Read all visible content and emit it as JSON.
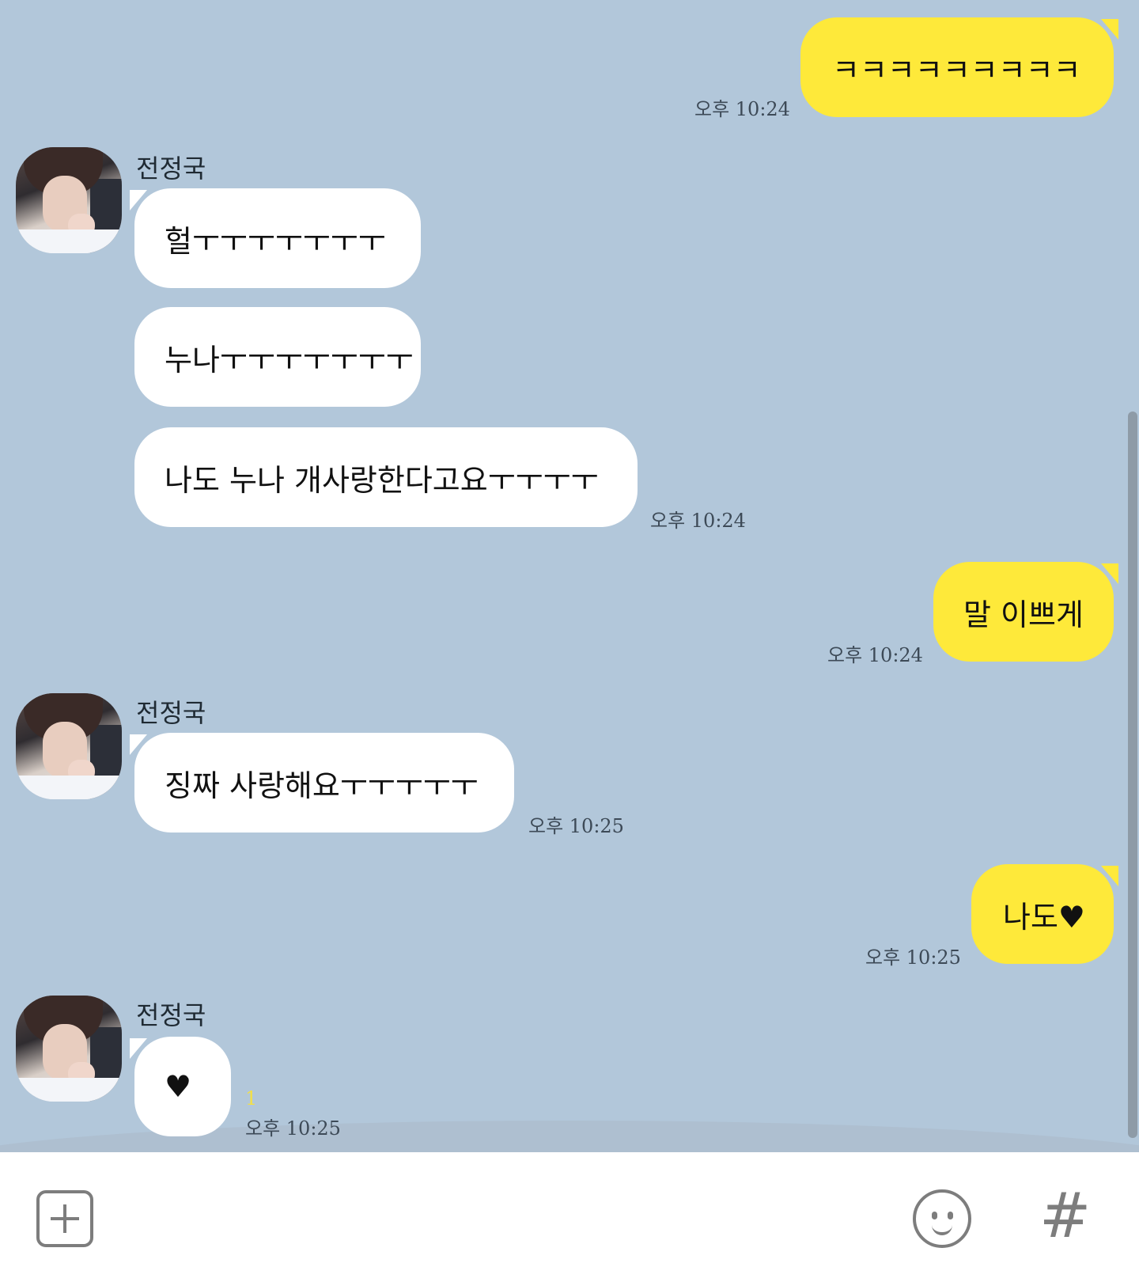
{
  "messages": [
    {
      "from": "me",
      "text": "ㅋㅋㅋㅋㅋㅋㅋㅋㅋ",
      "time": "오후 10:24"
    },
    {
      "from": "contact",
      "sender": "전정국",
      "text": "헐ㅜㅜㅜㅜㅜㅜㅜ"
    },
    {
      "from": "contact",
      "text": "누나ㅜㅜㅜㅜㅜㅜㅜ"
    },
    {
      "from": "contact",
      "text": "나도 누나 개사랑한다고요ㅜㅜㅜㅜ",
      "time": "오후 10:24"
    },
    {
      "from": "me",
      "text": "말 이쁘게",
      "time": "오후 10:24"
    },
    {
      "from": "contact",
      "sender": "전정국",
      "text": "징짜 사랑해요ㅜㅜㅜㅜㅜ",
      "time": "오후 10:25"
    },
    {
      "from": "me",
      "text": "나도♥",
      "time": "오후 10:25"
    },
    {
      "from": "contact",
      "sender": "전정국",
      "text": "♥",
      "unread": "1",
      "time": "오후 10:25"
    }
  ],
  "composer": {
    "plus_icon": "plus-square-icon",
    "emoji_icon": "smiley-icon",
    "hash_label": "#"
  },
  "colors": {
    "background": "#b2c7da",
    "my_bubble": "#fee93a",
    "their_bubble": "#ffffff"
  }
}
